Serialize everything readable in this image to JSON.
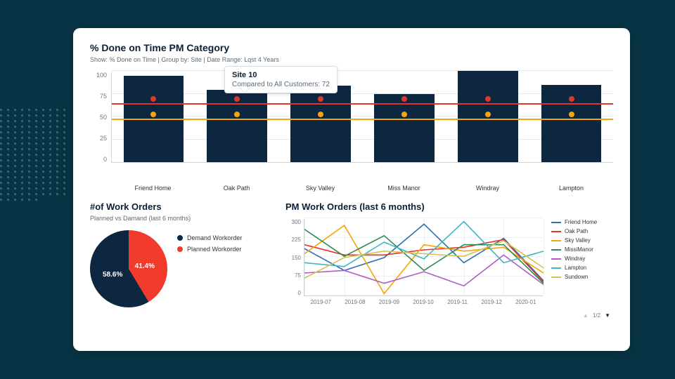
{
  "page": {
    "top": {
      "title": "% Done on Time PM Category",
      "subtitle": "Show: % Done on Time | Group by: Site | Date Range: Lqst 4 Years",
      "tooltip_title": "Site 10",
      "tooltip_body": "Compared to All Customers: 72"
    },
    "pie": {
      "title": "#of Work Orders",
      "subtitle": "Planned vs Damand (last 6 months)",
      "legend_demand": "Demand Workorder",
      "legend_planned": "Planned Workorder",
      "pct_demand": "58.6%",
      "pct_planned": "41.4%"
    },
    "line": {
      "title": "PM Work Orders (last 6 months)",
      "pager": "1/2"
    }
  },
  "chart_data": [
    {
      "id": "top_bar",
      "type": "bar",
      "title": "% Done on Time PM Category",
      "categories": [
        "Friend Home",
        "Oak Path",
        "Sky Valley",
        "Miss Manor",
        "Windray",
        "Lampton"
      ],
      "values": [
        95,
        79,
        84,
        75,
        100,
        85
      ],
      "reference_lines": [
        {
          "name": "upper",
          "value": 63,
          "color": "#e13528"
        },
        {
          "name": "lower",
          "value": 46,
          "color": "#f4a509"
        }
      ],
      "ylabel": "",
      "xlabel": "",
      "ylim": [
        0,
        100
      ],
      "yticks": [
        0,
        25,
        50,
        75,
        100
      ],
      "tooltip": {
        "label": "Site 10",
        "text": "Compared to All Customers: 72"
      }
    },
    {
      "id": "work_orders_pie",
      "type": "pie",
      "title": "#of Work Orders",
      "subtitle": "Planned vs Demand (last 6 months)",
      "slices": [
        {
          "name": "Demand Workorder",
          "value": 58.6,
          "color": "#0e2740"
        },
        {
          "name": "Planned Workorder",
          "value": 41.4,
          "color": "#f03b2d"
        }
      ]
    },
    {
      "id": "pm_work_orders_line",
      "type": "line",
      "title": "PM Work Orders (last 6 months)",
      "x": [
        "2019-07",
        "2019-08",
        "2019-09",
        "2019-10",
        "2019-11",
        "2019-12",
        "2020-01"
      ],
      "ylim": [
        0,
        300
      ],
      "yticks": [
        0,
        75,
        150,
        225,
        300
      ],
      "series": [
        {
          "name": "Friend Home",
          "color": "#2f6fb3",
          "values": [
            185,
            100,
            150,
            280,
            130,
            225,
            60
          ]
        },
        {
          "name": "Oak Path",
          "color": "#e13528",
          "values": [
            200,
            160,
            160,
            180,
            190,
            220,
            55
          ]
        },
        {
          "name": "Sky Valley",
          "color": "#f4a509",
          "values": [
            165,
            275,
            10,
            200,
            175,
            190,
            90
          ]
        },
        {
          "name": "MissiManor",
          "color": "#2e8b57",
          "values": [
            260,
            155,
            235,
            100,
            200,
            200,
            50
          ]
        },
        {
          "name": "Windray",
          "color": "#b15bc7",
          "values": [
            90,
            100,
            50,
            95,
            40,
            160,
            45
          ]
        },
        {
          "name": "Lampton",
          "color": "#3cb6c6",
          "values": [
            130,
            115,
            210,
            145,
            290,
            130,
            175
          ]
        },
        {
          "name": "Sundown",
          "color": "#d6c24d",
          "values": [
            70,
            150,
            175,
            165,
            155,
            215,
            110
          ]
        }
      ],
      "pager": {
        "current": 1,
        "total": 2
      }
    }
  ]
}
